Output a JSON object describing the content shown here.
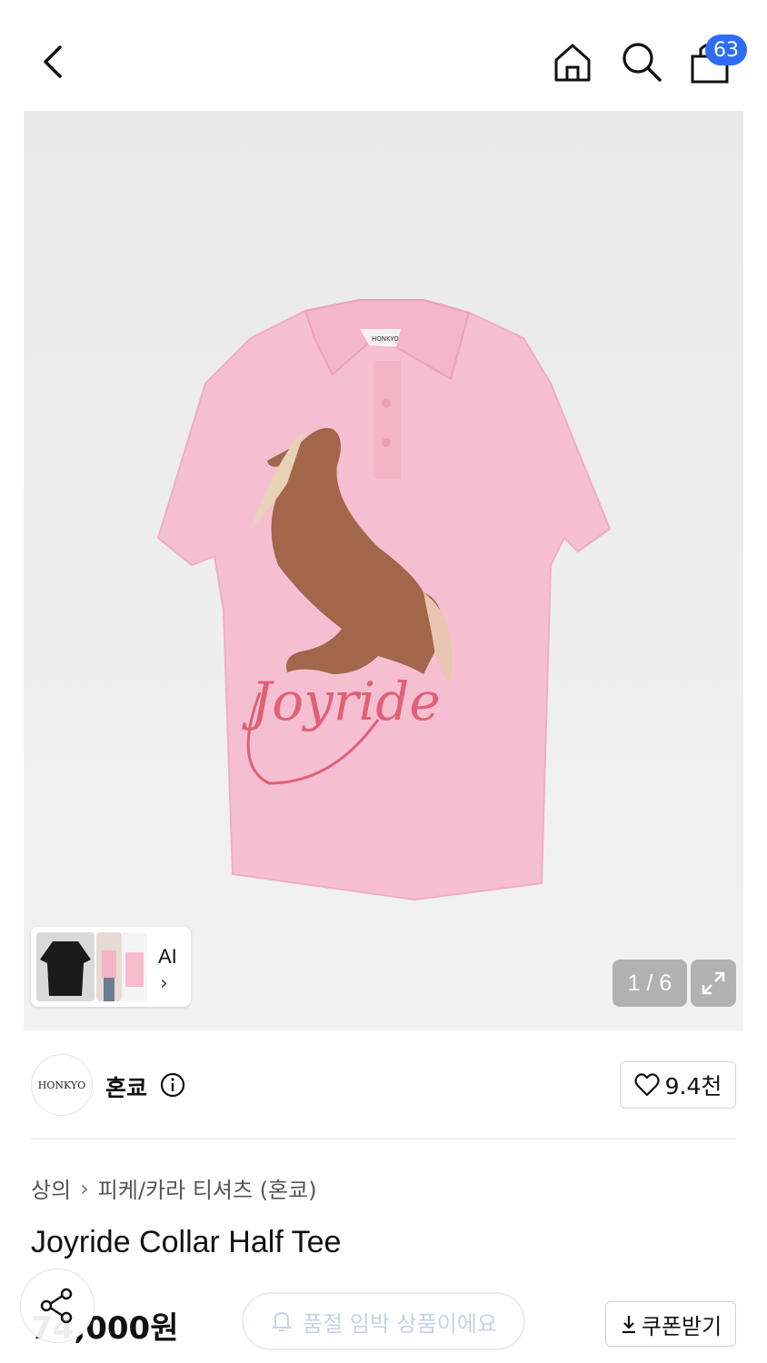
{
  "header": {
    "back_icon": "chevron-left-icon",
    "home_icon": "home-icon",
    "search_icon": "search-icon",
    "bag_icon": "shopping-bag-icon",
    "bag_count": "63",
    "badge_color": "#2f6cf6"
  },
  "gallery": {
    "thumbnail_ai_label": "AI",
    "page_counter": "1 / 6",
    "expand_icon": "expand-icon",
    "shirt_print_text": "Joyride",
    "shirt_collar_label": "HONKYO"
  },
  "brand": {
    "logo_text": "HONKYO",
    "name": "혼쿄",
    "info_icon": "info-icon",
    "like_icon": "heart-icon",
    "like_count": "9.4천"
  },
  "product": {
    "breadcrumb": [
      "상의",
      "피케/카라 티셔츠 (혼쿄)"
    ],
    "title": "Joyride Collar Half Tee",
    "price": "74,000원",
    "share_icon": "share-icon",
    "notice_icon": "bell-icon",
    "notice_text": "품절 임박 상품이에요",
    "coupon_icon": "download-icon",
    "coupon_label": "쿠폰받기"
  }
}
